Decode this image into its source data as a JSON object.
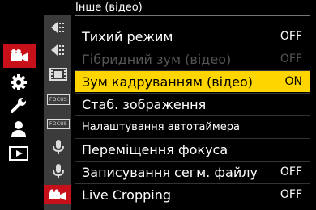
{
  "header": {
    "title": "Інше (відео)"
  },
  "icons": {
    "main_tabs": [
      "video-camera-icon",
      "gear-icon",
      "wrench-icon",
      "person-icon",
      "playback-icon"
    ],
    "sub_tabs": [
      "exposure-icon",
      "exposure-icon",
      "film-icon",
      "focus-icon",
      "focus-icon",
      "microphone-icon",
      "microphone-icon",
      "video-camera-icon"
    ]
  },
  "focus_label": "FOCUS",
  "menu": {
    "items": [
      {
        "label": "Тихий режим",
        "value": "OFF",
        "state": "normal"
      },
      {
        "label": "Гібридний зум (відео)",
        "value": "OFF",
        "state": "disabled"
      },
      {
        "label": "Зум кадруванням (відео)",
        "value": "ON",
        "state": "selected"
      },
      {
        "label": "Стаб. зображення",
        "value": "",
        "state": "normal"
      },
      {
        "label": "Налаштування автотаймера",
        "value": "",
        "state": "normal"
      },
      {
        "label": "Переміщення фокуса",
        "value": "",
        "state": "normal"
      },
      {
        "label": "Записування сегм. файлу",
        "value": "OFF",
        "state": "normal"
      },
      {
        "label": "Live Cropping",
        "value": "OFF",
        "state": "normal"
      }
    ]
  },
  "colors": {
    "accent_red": "#c8101b",
    "highlight_yellow": "#ffd500",
    "subtab_bg": "#3b3b3b"
  }
}
